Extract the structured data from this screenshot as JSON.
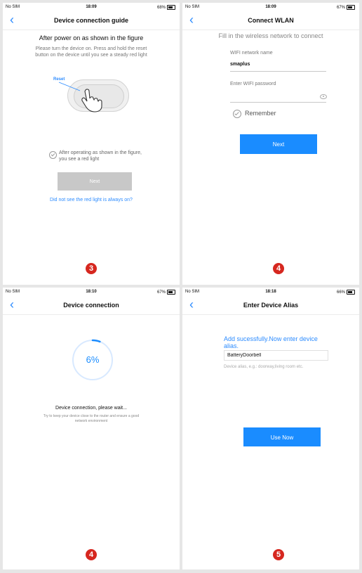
{
  "colors": {
    "accent": "#1a8cff",
    "badge": "#d6271f",
    "disabled": "#c8c8c8"
  },
  "panels": [
    {
      "status": {
        "carrier": "No SIM",
        "time": "18:09",
        "battery": "68%"
      },
      "title": "Device connection guide",
      "back_icon": "chevron-left-icon",
      "heading": "After power on as shown in the figure",
      "description": "Please turn the device on. Press and hold the reset button on the device until you see a steady red light",
      "reset_label": "Reset",
      "confirm_text": "After operating as shown in the figure, you see a red light",
      "next_label": "Next",
      "link_text": "Did not see the red light is always on?",
      "step_number": "3"
    },
    {
      "status": {
        "carrier": "No SIM",
        "time": "18:09",
        "battery": "67%"
      },
      "title": "Connect WLAN",
      "back_icon": "chevron-left-icon",
      "heading": "Fill in the wireless network to connect",
      "wifi_name_label": "WIFI network name",
      "wifi_name_value": "smaplus",
      "password_placeholder": "Enter WIFI password",
      "remember_label": "Remember",
      "next_label": "Next",
      "step_number": "4"
    },
    {
      "status": {
        "carrier": "No SIM",
        "time": "18:10",
        "battery": "67%"
      },
      "title": "Device connection",
      "back_icon": "chevron-left-icon",
      "progress_text": "6%",
      "progress_fraction": 0.06,
      "status_title": "Device connection, please wait...",
      "status_desc": "Try to keep your device close to the router and ensure a good network environment",
      "step_number": "4"
    },
    {
      "status": {
        "carrier": "No SIM",
        "time": "18:18",
        "battery": "66%"
      },
      "title": "Enter Device Alias",
      "back_icon": "chevron-left-icon",
      "heading": "Add sucessfully.Now enter device alias.",
      "alias_value": "BatteryDoorbell",
      "alias_hint": "Device alias, e.g.: doorway,living room etc.",
      "button_label": "Use Now",
      "step_number": "5"
    }
  ]
}
